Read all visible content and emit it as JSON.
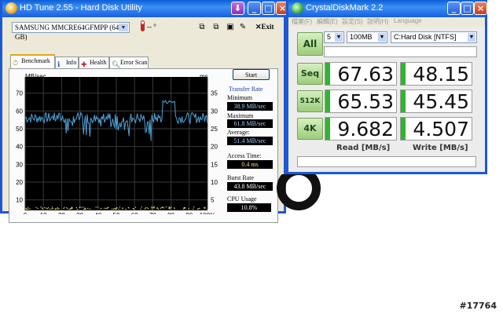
{
  "hdtune": {
    "title": "HD Tune 2.55 - Hard Disk Utility",
    "drive": "SAMSUNG MMCRE64GFMPP (64 GB)",
    "temp_label": "-- °",
    "exit_label": "Exit",
    "tabs": [
      {
        "label": "Benchmark",
        "icon": "stopwatch-icon"
      },
      {
        "label": "Info",
        "icon": "info-icon"
      },
      {
        "label": "Health",
        "icon": "health-cross-icon"
      },
      {
        "label": "Error Scan",
        "icon": "magnifier-icon"
      }
    ],
    "start_label": "Start",
    "transfer_rate_label": "Transfer Rate",
    "minimum_label": "Minimum",
    "minimum_value": "38.9 MB/sec",
    "maximum_label": "Maximum",
    "maximum_value": "61.8 MB/sec",
    "average_label": "Average:",
    "average_value": "51.4 MB/sec",
    "access_time_label": "Access Time:",
    "access_time_value": "0.4 ms",
    "burst_rate_label": "Burst Rate",
    "burst_rate_value": "43.8 MB/sec",
    "cpu_usage_label": "CPU Usage",
    "cpu_usage_value": "10.8%",
    "graph": {
      "left_unit": "MB/sec",
      "right_unit": "ms",
      "left_ticks": [
        "70",
        "60",
        "50",
        "40",
        "30",
        "20",
        "10"
      ],
      "right_ticks": [
        "35",
        "30",
        "25",
        "20",
        "15",
        "10",
        "5"
      ],
      "x_ticks": [
        "0",
        "10",
        "20",
        "30",
        "40",
        "50",
        "60",
        "70",
        "80",
        "90",
        "100%"
      ],
      "colors": {
        "background": "#000000",
        "grid": "#3a3a3a",
        "transfer": "#4fa3d9",
        "access": "#e8e070"
      }
    }
  },
  "cdm": {
    "title": "CrystalDiskMark 2.2",
    "menu": [
      "檔案(F)",
      "編輯(E)",
      "設定(S)",
      "說明(H)",
      "Language"
    ],
    "all_label": "All",
    "runs": "5",
    "size": "100MB",
    "drive": "C:Hard Disk [NTFS]",
    "rows": [
      {
        "label": "Seq",
        "read": "67.63",
        "write": "48.15"
      },
      {
        "label": "512K",
        "read": "65.53",
        "write": "45.45"
      },
      {
        "label": "4K",
        "read": "9.682",
        "write": "4.507"
      }
    ],
    "read_header": "Read [MB/s]",
    "write_header": "Write [MB/s]",
    "accent": "#2fb52f"
  },
  "watermark": "#17764"
}
